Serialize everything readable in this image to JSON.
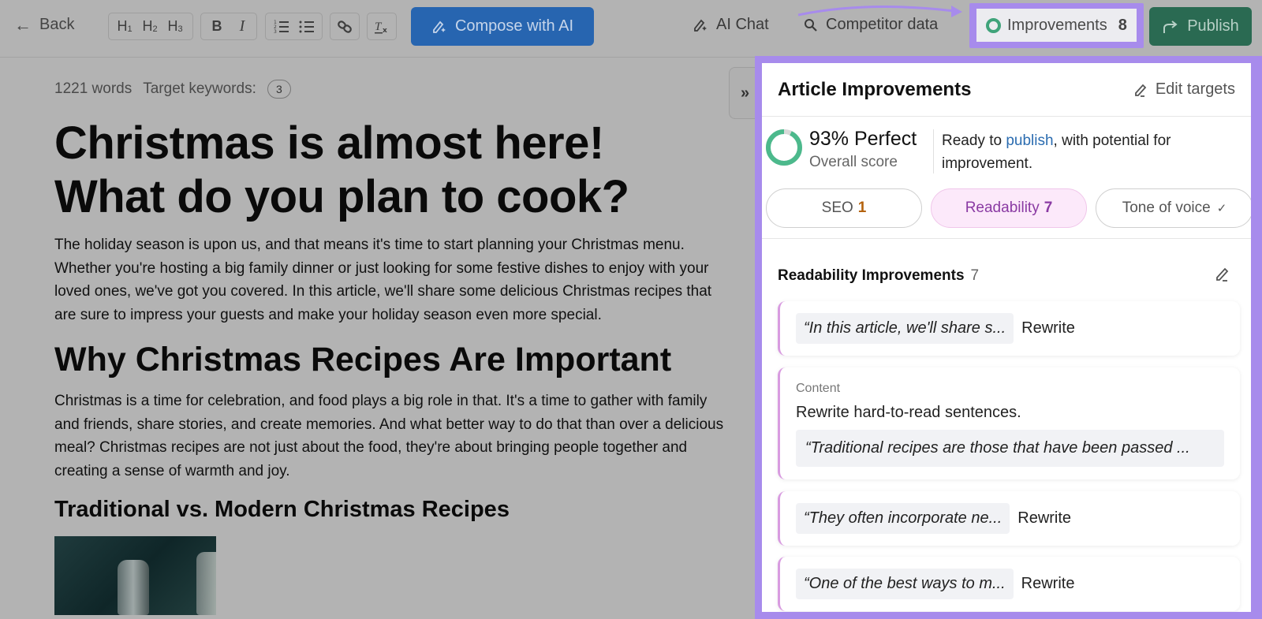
{
  "toolbar": {
    "back_label": "Back",
    "format_buttons": {
      "h1": "H",
      "h1_sub": "1",
      "h2": "H",
      "h2_sub": "2",
      "h3": "H",
      "h3_sub": "3",
      "bold": "B",
      "italic": "I",
      "ordered_list": "1≡",
      "bullet_list": "⁝≡",
      "link": "🔗",
      "clear_format": "Tx"
    },
    "compose_label": "Compose with AI",
    "ai_chat_label": "AI Chat",
    "competitor_label": "Competitor data",
    "improvements_label": "Improvements",
    "improvements_count": "8",
    "publish_label": "Publish"
  },
  "editor": {
    "word_count": "1221 words",
    "target_keywords_label": "Target keywords:",
    "target_keywords_count": "3",
    "title": "Christmas is almost here! What do you plan to cook?",
    "intro": "The holiday season is upon us, and that means it's time to start planning your Christmas menu. Whether you're hosting a big family dinner or just looking for some festive dishes to enjoy with your loved ones, we've got you covered. In this article, we'll share some delicious Christmas recipes that are sure to impress your guests and make your holiday season even more special.",
    "h2": "Why Christmas Recipes Are Important",
    "para2": "Christmas is a time for celebration, and food plays a big role in that. It's a time to gather with family and friends, share stories, and create memories. And what better way to do that than over a delicious meal? Christmas recipes are not just about the food, they're about bringing people together and creating a sense of warmth and joy.",
    "h3": "Traditional vs. Modern Christmas Recipes",
    "collapse_icon": "»"
  },
  "panel": {
    "title": "Article Improvements",
    "edit_targets_label": "Edit targets",
    "score_percent": 93,
    "score_text": "93% Perfect",
    "score_label": "Overall score",
    "message_before": "Ready to ",
    "message_link": "publish",
    "message_after": ", with potential for improvement.",
    "tabs": [
      {
        "label": "SEO",
        "count": "1"
      },
      {
        "label": "Readability",
        "count": "7"
      },
      {
        "label": "Tone of voice",
        "check": "✓"
      }
    ],
    "section_title": "Readability Improvements",
    "section_count": "7",
    "cards": [
      {
        "quote": "“In this article, we'll share s...",
        "action": "Rewrite"
      },
      {
        "label": "Content",
        "text": "Rewrite hard-to-read sentences.",
        "quote": "“Traditional recipes are those that have been passed ..."
      },
      {
        "quote": "“They often incorporate ne...",
        "action": "Rewrite"
      },
      {
        "quote": "“One of the best ways to m...",
        "action": "Rewrite"
      }
    ]
  },
  "colors": {
    "highlight": "#a78bec",
    "compose": "#2765b0",
    "publish": "#2a6a52",
    "score_ring": "#4cb98c",
    "readability_accent": "#8a3aa3",
    "seo_count": "#b4620d"
  }
}
